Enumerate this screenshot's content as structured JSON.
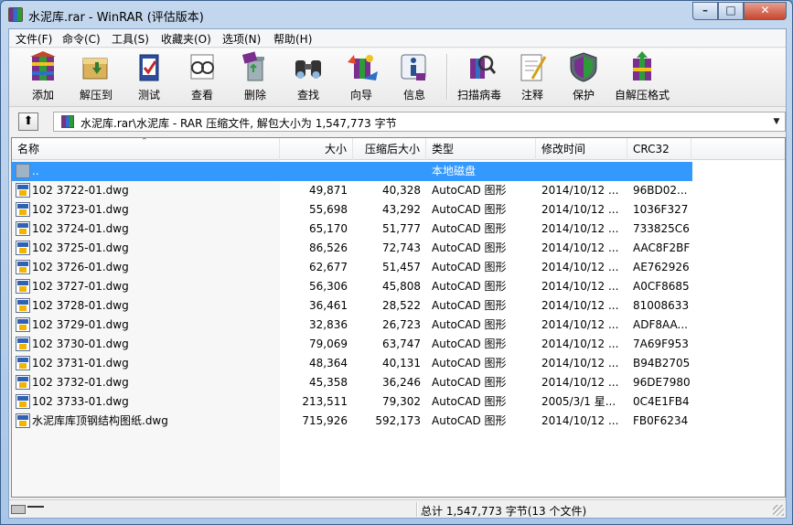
{
  "window": {
    "title": "水泥库.rar - WinRAR (评估版本)",
    "min_glyph": "–",
    "max_glyph": "□",
    "close_glyph": "✕"
  },
  "menubar": {
    "items": [
      "文件(F)",
      "命令(C)",
      "工具(S)",
      "收藏夹(O)",
      "选项(N)",
      "帮助(H)"
    ]
  },
  "toolbar": {
    "buttons": [
      {
        "label": "添加",
        "icon": "add-archive-icon"
      },
      {
        "label": "解压到",
        "icon": "extract-to-icon"
      },
      {
        "label": "测试",
        "icon": "test-icon"
      },
      {
        "label": "查看",
        "icon": "view-icon"
      },
      {
        "label": "删除",
        "icon": "delete-icon"
      },
      {
        "label": "查找",
        "icon": "find-icon"
      },
      {
        "label": "向导",
        "icon": "wizard-icon"
      },
      {
        "label": "信息",
        "icon": "info-icon"
      },
      {
        "label": "扫描病毒",
        "icon": "virus-scan-icon"
      },
      {
        "label": "注释",
        "icon": "comment-icon"
      },
      {
        "label": "保护",
        "icon": "protect-icon"
      },
      {
        "label": "自解压格式",
        "icon": "sfx-icon"
      }
    ]
  },
  "address": {
    "up_glyph": "⬆",
    "path": "水泥库.rar\\水泥库 - RAR 压缩文件, 解包大小为 1,547,773 字节",
    "dropdown_glyph": "▼"
  },
  "columns": {
    "name": "名称",
    "size": "大小",
    "packed": "压缩后大小",
    "type": "类型",
    "modified": "修改时间",
    "crc": "CRC32",
    "sort_glyph": "⌃"
  },
  "files": [
    {
      "name": "..",
      "size": "",
      "packed": "",
      "type": "本地磁盘",
      "modified": "",
      "crc": "",
      "selected": true,
      "icon": "folder-up-icon"
    },
    {
      "name": "102 3722-01.dwg",
      "size": "49,871",
      "packed": "40,328",
      "type": "AutoCAD 图形",
      "modified": "2014/10/12 ...",
      "crc": "96BD02...",
      "icon": "dwg-file-icon"
    },
    {
      "name": "102 3723-01.dwg",
      "size": "55,698",
      "packed": "43,292",
      "type": "AutoCAD 图形",
      "modified": "2014/10/12 ...",
      "crc": "1036F327",
      "icon": "dwg-file-icon"
    },
    {
      "name": "102 3724-01.dwg",
      "size": "65,170",
      "packed": "51,777",
      "type": "AutoCAD 图形",
      "modified": "2014/10/12 ...",
      "crc": "733825C6",
      "icon": "dwg-file-icon"
    },
    {
      "name": "102 3725-01.dwg",
      "size": "86,526",
      "packed": "72,743",
      "type": "AutoCAD 图形",
      "modified": "2014/10/12 ...",
      "crc": "AAC8F2BF",
      "icon": "dwg-file-icon"
    },
    {
      "name": "102 3726-01.dwg",
      "size": "62,677",
      "packed": "51,457",
      "type": "AutoCAD 图形",
      "modified": "2014/10/12 ...",
      "crc": "AE762926",
      "icon": "dwg-file-icon"
    },
    {
      "name": "102 3727-01.dwg",
      "size": "56,306",
      "packed": "45,808",
      "type": "AutoCAD 图形",
      "modified": "2014/10/12 ...",
      "crc": "A0CF8685",
      "icon": "dwg-file-icon"
    },
    {
      "name": "102 3728-01.dwg",
      "size": "36,461",
      "packed": "28,522",
      "type": "AutoCAD 图形",
      "modified": "2014/10/12 ...",
      "crc": "81008633",
      "icon": "dwg-file-icon"
    },
    {
      "name": "102 3729-01.dwg",
      "size": "32,836",
      "packed": "26,723",
      "type": "AutoCAD 图形",
      "modified": "2014/10/12 ...",
      "crc": "ADF8AA...",
      "icon": "dwg-file-icon"
    },
    {
      "name": "102 3730-01.dwg",
      "size": "79,069",
      "packed": "63,747",
      "type": "AutoCAD 图形",
      "modified": "2014/10/12 ...",
      "crc": "7A69F953",
      "icon": "dwg-file-icon"
    },
    {
      "name": "102 3731-01.dwg",
      "size": "48,364",
      "packed": "40,131",
      "type": "AutoCAD 图形",
      "modified": "2014/10/12 ...",
      "crc": "B94B2705",
      "icon": "dwg-file-icon"
    },
    {
      "name": "102 3732-01.dwg",
      "size": "45,358",
      "packed": "36,246",
      "type": "AutoCAD 图形",
      "modified": "2014/10/12 ...",
      "crc": "96DE7980",
      "icon": "dwg-file-icon"
    },
    {
      "name": "102 3733-01.dwg",
      "size": "213,511",
      "packed": "79,302",
      "type": "AutoCAD 图形",
      "modified": "2005/3/1 星...",
      "crc": "0C4E1FB4",
      "icon": "dwg-file-icon"
    },
    {
      "name": "水泥库库顶钢结构图纸.dwg",
      "size": "715,926",
      "packed": "592,173",
      "type": "AutoCAD 图形",
      "modified": "2014/10/12 ...",
      "crc": "FB0F6234",
      "icon": "dwg-file-icon"
    }
  ],
  "status": {
    "total": "总计 1,547,773 字节(13 个文件)"
  },
  "colors": {
    "selection": "#3399ff",
    "titlebar": "#a9c6e8"
  }
}
